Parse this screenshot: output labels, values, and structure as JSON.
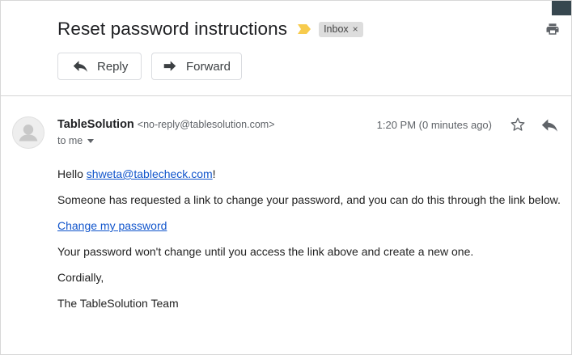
{
  "subject": "Reset password instructions",
  "label": {
    "text": "Inbox",
    "remove": "×"
  },
  "buttons": {
    "reply": "Reply",
    "forward": "Forward"
  },
  "message": {
    "sender_name": "TableSolution",
    "sender_email": "<no-reply@tablesolution.com>",
    "time": "1:20 PM (0 minutes ago)",
    "recipient": "to me",
    "greeting_prefix": "Hello ",
    "greeting_email": "shweta@tablecheck.com",
    "greeting_suffix": "!",
    "line1": "Someone has requested a link to change your password, and you can do this through the link below.",
    "link_text": "Change my password",
    "line2": "Your password won't change until you access the link above and create a new one.",
    "closing": "Cordially,",
    "signature": "The TableSolution Team"
  },
  "colors": {
    "link": "#1155cc",
    "importance": "#f7cb4d",
    "chip_bg": "#dddddd"
  },
  "icons": [
    "importance-marker-icon",
    "close-icon",
    "print-icon",
    "reply-icon",
    "forward-icon",
    "avatar-icon",
    "star-icon",
    "chevron-down-icon"
  ]
}
